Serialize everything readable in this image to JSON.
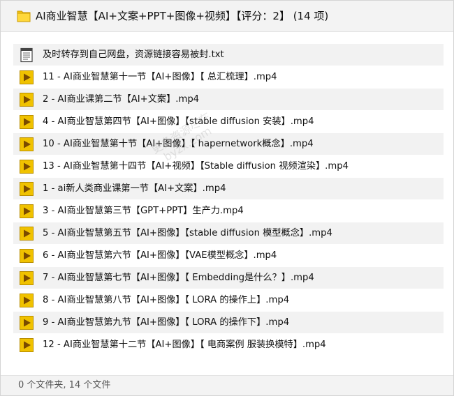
{
  "header": {
    "title": "AI商业智慧【AI+文案+PPT+图像+视频】【评分：2】 (14 项)",
    "icon": "folder-icon"
  },
  "files": [
    {
      "name": "及时转存到自己网盘，资源链接容易被封.txt",
      "type": "txt"
    },
    {
      "name": "11 - AI商业智慧第十一节【AI+图像】【 总汇梳理】.mp4",
      "type": "mp4"
    },
    {
      "name": "2 - AI商业课第二节【AI+文案】.mp4",
      "type": "mp4"
    },
    {
      "name": "4 - AI商业智慧第四节【AI+图像】【stable diffusion 安装】.mp4",
      "type": "mp4"
    },
    {
      "name": "10 - AI商业智慧第十节【AI+图像】【 hapernetwork概念】.mp4",
      "type": "mp4"
    },
    {
      "name": "13 - AI商业智慧第十四节【AI+视频】【Stable diffusion 视频渲染】.mp4",
      "type": "mp4"
    },
    {
      "name": "1 - ai新人类商业课第一节【AI+文案】.mp4",
      "type": "mp4"
    },
    {
      "name": "3 - AI商业智慧第三节【GPT+PPT】生产力.mp4",
      "type": "mp4"
    },
    {
      "name": "5 - AI商业智慧第五节【AI+图像】【stable diffusion 模型概念】.mp4",
      "type": "mp4"
    },
    {
      "name": "6 - AI商业智慧第六节【AI+图像】【VAE模型概念】.mp4",
      "type": "mp4"
    },
    {
      "name": "7 - AI商业智慧第七节【AI+图像】【 Embedding是什么？】.mp4",
      "type": "mp4"
    },
    {
      "name": "8 - AI商业智慧第八节【AI+图像】【 LORA 的操作上】.mp4",
      "type": "mp4"
    },
    {
      "name": "9 - AI商业智慧第九节【AI+图像】【 LORA 的操作下】.mp4",
      "type": "mp4"
    },
    {
      "name": "12 - AI商业智慧第十二节【AI+图像】【 电商案例 服装换模特】.mp4",
      "type": "mp4"
    }
  ],
  "footer": {
    "summary": "0 个文件夹, 14 个文件"
  },
  "watermark": {
    "line1": "更多资源尽在",
    "line2": "byzx.com"
  },
  "colors": {
    "folder": "#f5c518",
    "video_icon": "#e8b400",
    "row_bg": "#f2f2f2"
  }
}
